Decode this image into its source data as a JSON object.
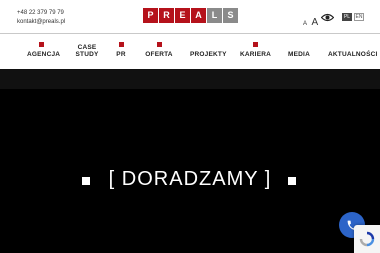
{
  "contact": {
    "phone": "+48 22 379 79 79",
    "email": "kontakt@preals.pl"
  },
  "logo": {
    "letters": [
      "P",
      "R",
      "E",
      "A",
      "L",
      "S"
    ]
  },
  "accessibility": {
    "font_small": "A",
    "font_large": "A",
    "contrast_icon": "eye-icon"
  },
  "languages": {
    "pl": "PL",
    "en": "EN"
  },
  "nav": {
    "agencja": "AGENCJA",
    "case_line1": "CASE",
    "case_line2": "STUDY",
    "pr": "PR",
    "oferta": "OFERTA",
    "projekty": "PROJEKTY",
    "kariera": "KARIERA",
    "media": "MEDIA",
    "aktualnosci": "AKTUALNOŚCI"
  },
  "hero": {
    "title": "[ DORADZAMY ]"
  },
  "colors": {
    "brand_red": "#b5121b",
    "logo_grey": "#8a8a8a",
    "phone_button": "#2c64c8"
  }
}
